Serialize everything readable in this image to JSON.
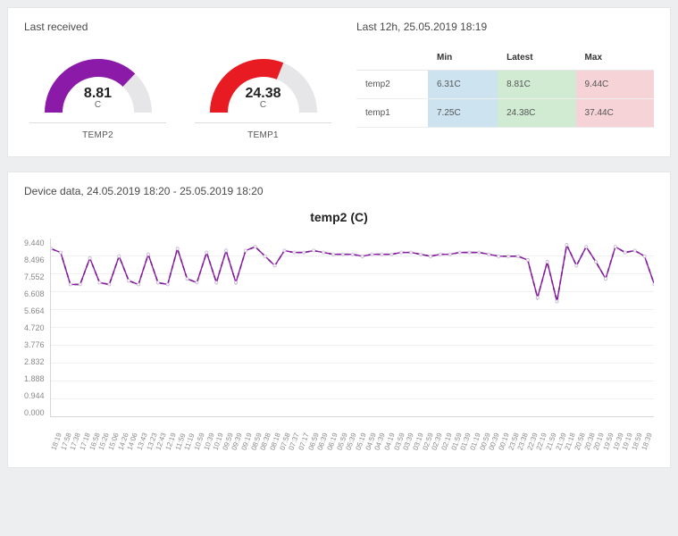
{
  "last_received": {
    "title": "Last received",
    "gauges": [
      {
        "name": "TEMP2",
        "value": "8.81",
        "unit": "C",
        "color": "#8c1aa8",
        "fill": 0.74
      },
      {
        "name": "TEMP1",
        "value": "24.38",
        "unit": "C",
        "color": "#e81b23",
        "fill": 0.62
      }
    ]
  },
  "summary": {
    "title": "Last 12h, 25.05.2019 18:19",
    "columns": [
      "Min",
      "Latest",
      "Max"
    ],
    "rows": [
      {
        "name": "temp2",
        "min": "6.31C",
        "latest": "8.81C",
        "max": "9.44C"
      },
      {
        "name": "temp1",
        "min": "7.25C",
        "latest": "24.38C",
        "max": "37.44C"
      }
    ]
  },
  "device_data": {
    "title": "Device data, 24.05.2019 18:20 - 25.05.2019 18:20"
  },
  "chart_data": {
    "type": "line",
    "title": "temp2 (C)",
    "xlabel": "",
    "ylabel": "",
    "ylim": [
      0,
      9.44
    ],
    "y_ticks": [
      "9.440",
      "8.496",
      "7.552",
      "6.608",
      "5.664",
      "4.720",
      "3.776",
      "2.832",
      "1.888",
      "0.944",
      "0.000"
    ],
    "categories": [
      "18:19",
      "17:58",
      "17:38",
      "17:18",
      "16:58",
      "15:26",
      "15:06",
      "14:26",
      "14:06",
      "13:43",
      "13:23",
      "12:43",
      "12:19",
      "11:59",
      "11:19",
      "10:59",
      "10:39",
      "10:19",
      "09:59",
      "09:39",
      "09:19",
      "08:59",
      "08:38",
      "08:18",
      "07:58",
      "07:37",
      "07:17",
      "06:59",
      "06:39",
      "06:19",
      "05:59",
      "05:39",
      "05:19",
      "04:59",
      "04:39",
      "04:19",
      "03:59",
      "03:39",
      "03:19",
      "02:59",
      "02:39",
      "02:19",
      "01:59",
      "01:39",
      "01:19",
      "00:59",
      "00:39",
      "00:19",
      "23:58",
      "23:38",
      "22:39",
      "22:19",
      "21:59",
      "21:39",
      "21:18",
      "20:58",
      "20:38",
      "20:19",
      "19:59",
      "19:39",
      "19:19",
      "18:59",
      "18:39"
    ],
    "series": [
      {
        "name": "temp2",
        "color": "#8c1aa8",
        "values": [
          8.9,
          8.7,
          7.0,
          7.0,
          8.4,
          7.1,
          7.0,
          8.5,
          7.2,
          7.0,
          8.6,
          7.1,
          7.0,
          8.9,
          7.3,
          7.1,
          8.7,
          7.1,
          8.8,
          7.1,
          8.8,
          9.0,
          8.5,
          8.0,
          8.8,
          8.7,
          8.7,
          8.8,
          8.7,
          8.6,
          8.6,
          8.6,
          8.5,
          8.6,
          8.6,
          8.6,
          8.7,
          8.7,
          8.6,
          8.5,
          8.6,
          8.6,
          8.7,
          8.7,
          8.7,
          8.6,
          8.5,
          8.5,
          8.5,
          8.3,
          6.3,
          8.2,
          6.1,
          9.1,
          8.0,
          9.0,
          8.2,
          7.3,
          9.0,
          8.7,
          8.8,
          8.5,
          7.0
        ]
      }
    ]
  }
}
